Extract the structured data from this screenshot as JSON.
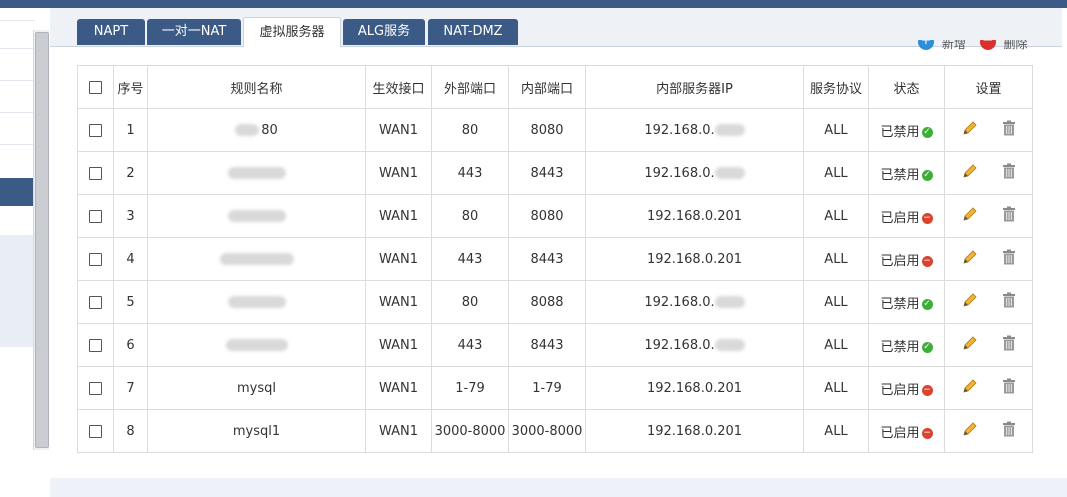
{
  "tabs": [
    {
      "label": "NAPT",
      "active": false
    },
    {
      "label": "一对一NAT",
      "active": false
    },
    {
      "label": "虚拟服务器",
      "active": true
    },
    {
      "label": "ALG服务",
      "active": false
    },
    {
      "label": "NAT-DMZ",
      "active": false
    }
  ],
  "actions": {
    "add_label": "新增",
    "delete_label": "删除",
    "add_icon": "plus-circle-icon",
    "delete_icon": "minus-circle-icon"
  },
  "table": {
    "headers": [
      "序号",
      "规则名称",
      "生效接口",
      "外部端口",
      "内部端口",
      "内部服务器IP",
      "服务协议",
      "状态",
      "设置"
    ],
    "rows": [
      {
        "id": "1",
        "name": "80",
        "iface": "WAN1",
        "ext": "80",
        "int": "8080",
        "ip": "192.168.0.",
        "proto": "ALL",
        "status": "已禁用",
        "status_kind": "ok"
      },
      {
        "id": "2",
        "name": "",
        "iface": "WAN1",
        "ext": "443",
        "int": "8443",
        "ip": "192.168.0.",
        "proto": "ALL",
        "status": "已禁用",
        "status_kind": "ok"
      },
      {
        "id": "3",
        "name": "",
        "iface": "WAN1",
        "ext": "80",
        "int": "8080",
        "ip": "192.168.0.201",
        "proto": "ALL",
        "status": "已启用",
        "status_kind": "stop"
      },
      {
        "id": "4",
        "name": "",
        "iface": "WAN1",
        "ext": "443",
        "int": "8443",
        "ip": "192.168.0.201",
        "proto": "ALL",
        "status": "已启用",
        "status_kind": "stop"
      },
      {
        "id": "5",
        "name": "",
        "iface": "WAN1",
        "ext": "80",
        "int": "8088",
        "ip": "192.168.0.",
        "proto": "ALL",
        "status": "已禁用",
        "status_kind": "ok"
      },
      {
        "id": "6",
        "name": "",
        "iface": "WAN1",
        "ext": "443",
        "int": "8443",
        "ip": "192.168.0.",
        "proto": "ALL",
        "status": "已禁用",
        "status_kind": "ok"
      },
      {
        "id": "7",
        "name": "mysql",
        "iface": "WAN1",
        "ext": "1-79",
        "int": "1-79",
        "ip": "192.168.0.201",
        "proto": "ALL",
        "status": "已启用",
        "status_kind": "stop"
      },
      {
        "id": "8",
        "name": "mysql1",
        "iface": "WAN1",
        "ext": "3000-8000",
        "int": "3000-8000",
        "ip": "192.168.0.201",
        "proto": "ALL",
        "status": "已启用",
        "status_kind": "stop"
      }
    ]
  },
  "colors": {
    "accent": "#3b5b86",
    "enabled_ok": "#3dae3a",
    "stop": "#d9432f"
  }
}
